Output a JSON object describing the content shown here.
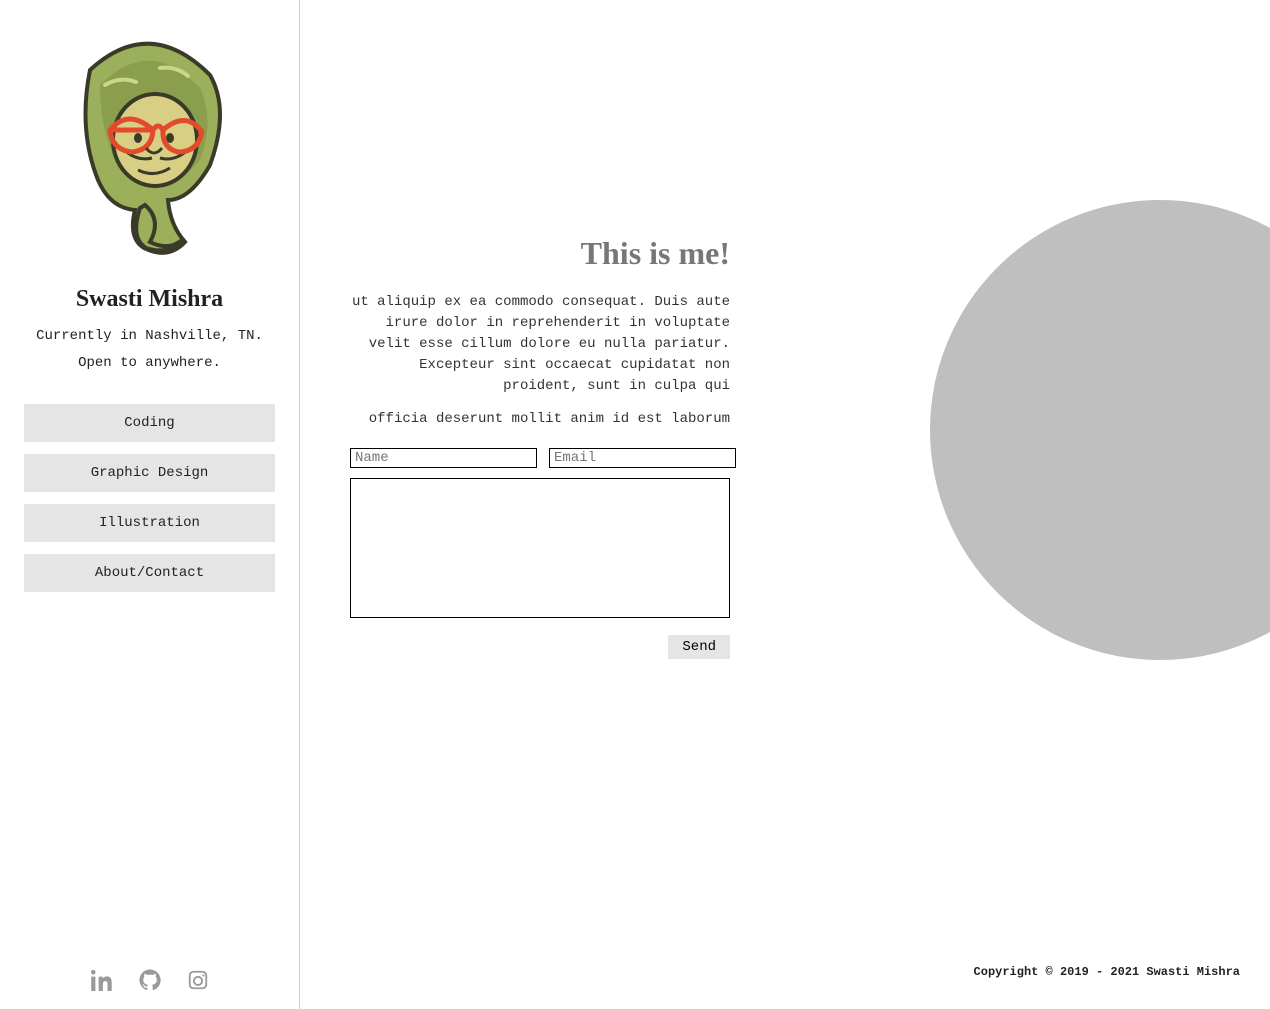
{
  "sidebar": {
    "name": "Swasti Mishra",
    "tagline_line1": "Currently in Nashville, TN.",
    "tagline_line2": "Open to anywhere.",
    "nav": [
      {
        "label": "Coding"
      },
      {
        "label": "Graphic Design"
      },
      {
        "label": "Illustration"
      },
      {
        "label": "About/Contact"
      }
    ],
    "social": {
      "linkedin": "linkedin-icon",
      "github": "github-icon",
      "instagram": "instagram-icon"
    }
  },
  "main": {
    "heading": "This is me!",
    "paragraph1": "ut aliquip ex ea commodo consequat. Duis aute irure dolor in reprehenderit in voluptate velit esse cillum dolore eu nulla pariatur. Excepteur sint occaecat cupidatat non proident, sunt in culpa qui",
    "paragraph2": "officia deserunt mollit anim id est laborum",
    "form": {
      "name_placeholder": "Name",
      "email_placeholder": "Email",
      "message_placeholder": "",
      "send_label": "Send"
    },
    "copyright": "Copyright © 2019 - 2021 Swasti Mishra"
  },
  "colors": {
    "sidebar_border": "#cccccc",
    "nav_bg": "#e5e5e5",
    "heading_gray": "#777777",
    "circle_gray": "#bfbfbf",
    "icon_gray": "#9a9a9a",
    "avatar_hair": "#9caf5a",
    "avatar_hair_dark": "#6e7e3a",
    "avatar_skin": "#d9cf84",
    "avatar_glasses": "#e24a2b"
  }
}
